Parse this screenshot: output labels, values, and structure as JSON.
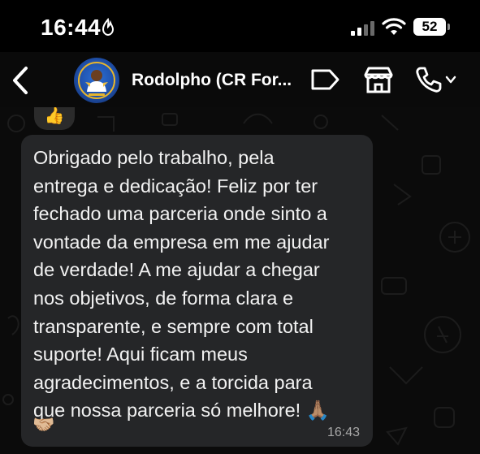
{
  "status_bar": {
    "time": "16:44",
    "battery": "52",
    "icons": [
      "focus-icon",
      "signal-icon",
      "wifi-icon",
      "battery-icon"
    ]
  },
  "header": {
    "contact_name": "Rodolpho (CR For...",
    "icons": [
      "back-icon",
      "avatar",
      "label-tag-icon",
      "store-icon",
      "phone-icon",
      "chevron-down-icon"
    ]
  },
  "messages": [
    {
      "text": "Obrigado pelo trabalho, pela\nentrega e dedicação! Feliz por ter\nfechado uma parceria onde sinto a\nvontade da empresa em me ajudar\nde verdade! A me ajudar a chegar\nnos objetivos, de forma clara e\ntransparente, e sempre com total\nsuporte! Aqui ficam meus\nagradecimentos, e a torcida para\nque nossa parceria só melhore! 🙏🏽",
      "time": "16:43",
      "reaction": "🤝🏼"
    }
  ],
  "previous_reaction": "👍",
  "colors": {
    "background": "#0b0b0b",
    "bubble": "#252628",
    "text": "#f2f2f2",
    "timestamp": "#a8a8a8",
    "avatar_blue": "#1f4fa8"
  }
}
